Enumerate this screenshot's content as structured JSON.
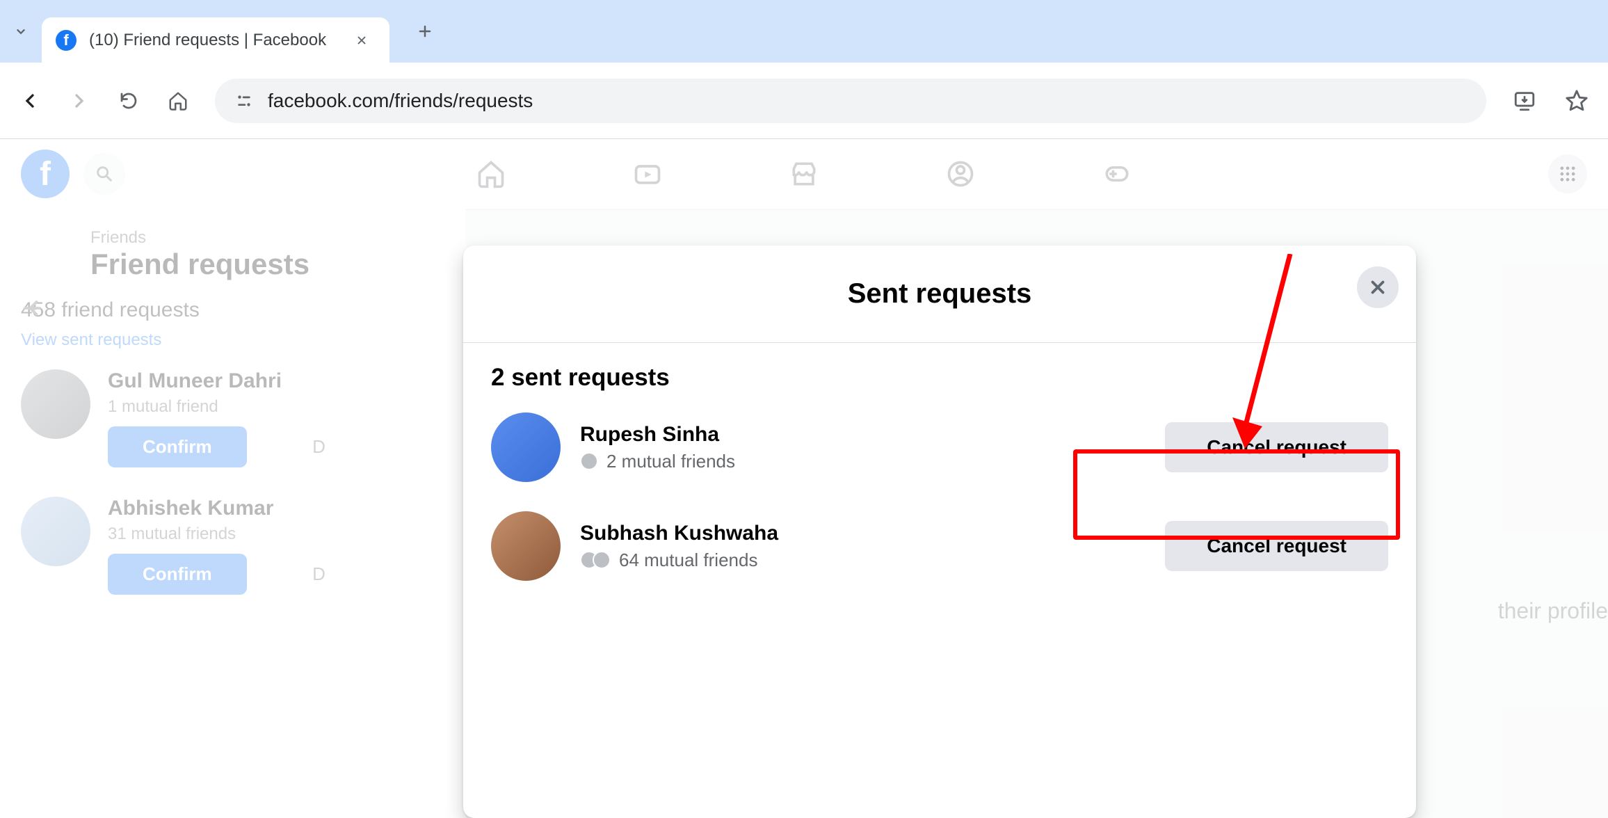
{
  "browser": {
    "tab_title": "(10) Friend requests | Facebook",
    "url": "facebook.com/friends/requests"
  },
  "sidebar": {
    "breadcrumb": "Friends",
    "title": "Friend requests",
    "count_text": "458 friend requests",
    "view_sent_link": "View sent requests",
    "requests": [
      {
        "name": "Gul Muneer Dahri",
        "mutual": "1 mutual friend",
        "confirm": "Confirm",
        "delete_hint": "D"
      },
      {
        "name": "Abhishek Kumar",
        "mutual": "31 mutual friends",
        "confirm": "Confirm",
        "delete_hint": "D"
      }
    ]
  },
  "hint_right": "their profile",
  "modal": {
    "title": "Sent requests",
    "subtitle": "2 sent requests",
    "items": [
      {
        "name": "Rupesh Sinha",
        "mutual": "2 mutual friends",
        "cancel": "Cancel request"
      },
      {
        "name": "Subhash Kushwaha",
        "mutual": "64 mutual friends",
        "cancel": "Cancel request"
      }
    ]
  }
}
